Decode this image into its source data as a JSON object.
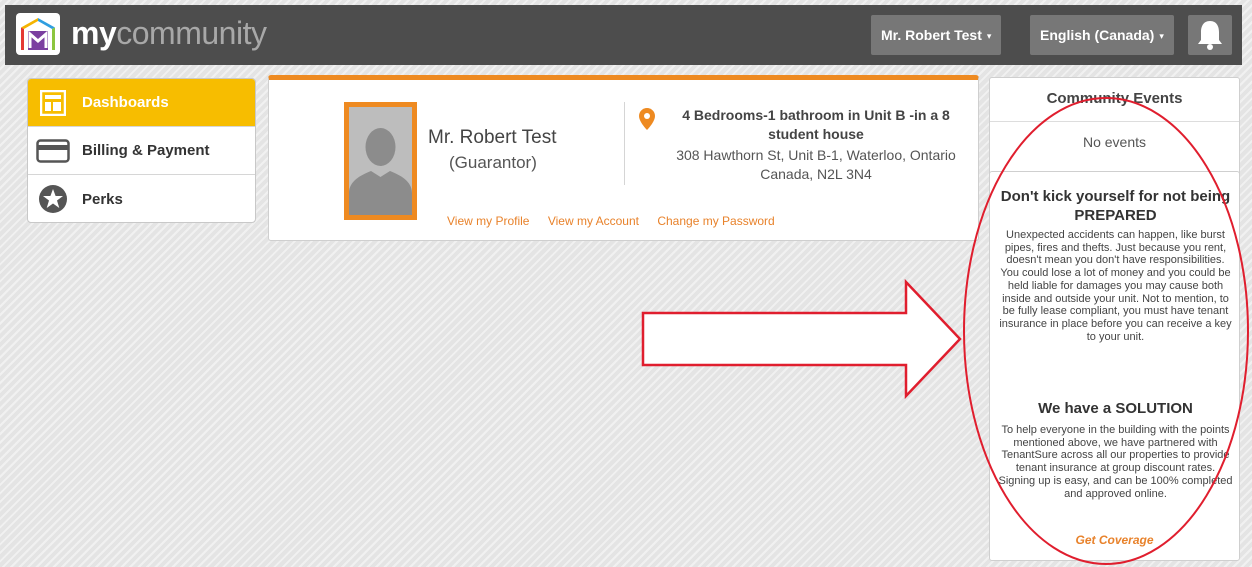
{
  "header": {
    "brand_bold": "my",
    "brand_light": "community",
    "user_menu": "Mr. Robert Test",
    "language_menu": "English (Canada)",
    "caret": "▾"
  },
  "sidebar": {
    "items": [
      {
        "label": "Dashboards",
        "icon": "dashboard-icon",
        "active": true
      },
      {
        "label": "Billing & Payment",
        "icon": "credit-card-icon",
        "active": false
      },
      {
        "label": "Perks",
        "icon": "star-icon",
        "active": false
      }
    ]
  },
  "profile": {
    "name": "Mr. Robert Test",
    "role": "(Guarantor)",
    "unit_title": "4 Bedrooms-1 bathroom in Unit B -in a 8 student house",
    "address": "308 Hawthorn St, Unit B-1, Waterloo, Ontario Canada, N2L 3N4",
    "links": [
      "View my Profile",
      "View my Account",
      "Change my Password"
    ]
  },
  "events": {
    "title": "Community Events",
    "empty_text": "No events"
  },
  "insurance": {
    "heading1": "Don't kick yourself for not being PREPARED",
    "para1": "Unexpected accidents can happen, like burst pipes, fires and thefts. Just because you rent, doesn't mean you don't have responsibilities. You could lose a lot of money and you could be held liable for damages you may cause both inside and outside your unit. Not to mention, to be fully lease compliant, you must have tenant insurance in place before you can receive a key to your unit.",
    "heading2": "We have a SOLUTION",
    "para2": "To help everyone in the building with the points mentioned above, we have partnered with TenantSure across all our properties to provide tenant insurance at group discount rates. Signing up is easy, and can be 100% completed and approved online.",
    "cta": "Get Coverage"
  },
  "colors": {
    "accent": "#ee8a21",
    "active_nav": "#f7bd00",
    "topbar": "#4d4d4d",
    "annotation": "#e01e2e"
  }
}
